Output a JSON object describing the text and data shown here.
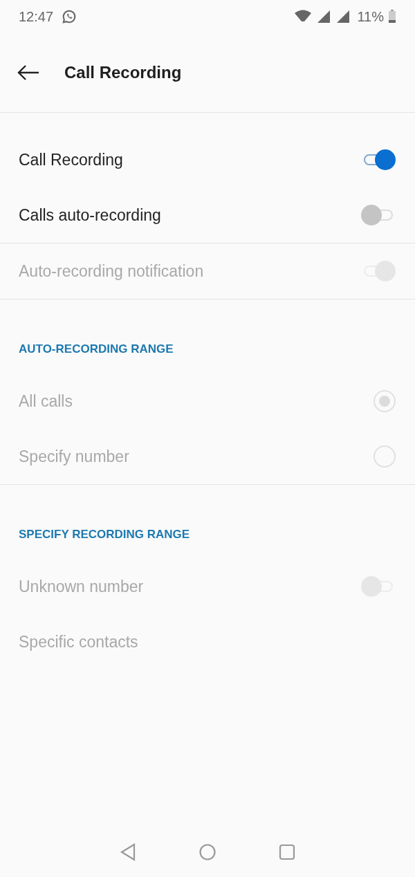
{
  "status_bar": {
    "time": "12:47",
    "battery": "11%"
  },
  "header": {
    "title": "Call Recording"
  },
  "groups": [
    {
      "items": [
        {
          "kind": "toggle",
          "label": "Call Recording",
          "on": true,
          "disabled": false
        },
        {
          "kind": "toggle",
          "label": "Calls auto-recording",
          "on": false,
          "disabled": false
        }
      ]
    },
    {
      "items": [
        {
          "kind": "toggle",
          "label": "Auto-recording notification",
          "on": true,
          "disabled": true
        }
      ]
    },
    {
      "heading": "AUTO-RECORDING RANGE",
      "items": [
        {
          "kind": "radio",
          "label": "All calls",
          "selected": true,
          "disabled": true
        },
        {
          "kind": "radio",
          "label": "Specify number",
          "selected": false,
          "disabled": true
        }
      ]
    },
    {
      "heading": "SPECIFY RECORDING RANGE",
      "items": [
        {
          "kind": "toggle",
          "label": "Unknown number",
          "on": false,
          "disabled": true
        },
        {
          "kind": "plain",
          "label": "Specific contacts",
          "disabled": true
        }
      ]
    }
  ]
}
